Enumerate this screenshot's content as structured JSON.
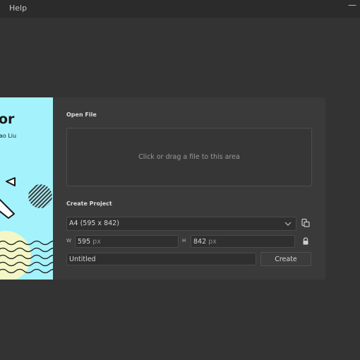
{
  "menubar": {
    "help_label": "Help",
    "minimize_glyph": "—"
  },
  "splash": {
    "title_fragment": "or",
    "author_fragment": "ao Liu",
    "background": "#a4f2fb"
  },
  "open_file": {
    "title": "Open File",
    "dropzone_text": "Click or drag a file to this area"
  },
  "create_project": {
    "title": "Create Project",
    "preset_selected": "A4 (595 x 842)",
    "width_label": "W",
    "width_value": "595",
    "width_unit": "px",
    "height_label": "H",
    "height_value": "842",
    "height_unit": "px",
    "name_value": "Untitled",
    "create_label": "Create",
    "swap_icon": "swap-orientation-icon",
    "lock_icon": "lock-icon"
  },
  "colors": {
    "background": "#333333",
    "dialog": "#3a3a3a",
    "input": "#2f2f2f",
    "splash_accent": "#a4f2fb"
  }
}
